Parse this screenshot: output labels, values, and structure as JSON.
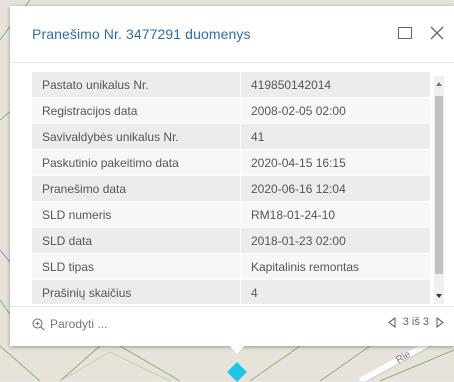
{
  "popup": {
    "title": "Pranešimo Nr. 3477291 duomenys",
    "maximize_icon": "maximize-icon",
    "close_icon": "close-icon"
  },
  "attributes": [
    {
      "key": "Pastato unikalus Nr.",
      "value": "419850142014"
    },
    {
      "key": "Registracijos data",
      "value": "2008-02-05 02:00"
    },
    {
      "key": "Savivaldybės unikalus Nr.",
      "value": "41"
    },
    {
      "key": "Paskutinio pakeitimo data",
      "value": "2020-04-15 16:15"
    },
    {
      "key": "Pranešimo data",
      "value": "2020-06-16 12:04"
    },
    {
      "key": "SLD numeris",
      "value": "RM18-01-24-10"
    },
    {
      "key": "SLD data",
      "value": "2018-01-23 02:00"
    },
    {
      "key": "SLD tipas",
      "value": "Kapitalinis remontas"
    },
    {
      "key": "Prašinių skaičius",
      "value": "4"
    }
  ],
  "footer": {
    "zoom_label": "Parodyti ...",
    "pager_label": "3 iš 3"
  },
  "map": {
    "road_label": "Rie"
  },
  "colors": {
    "title": "#2e6fa3",
    "marker": "#19c7e6"
  }
}
